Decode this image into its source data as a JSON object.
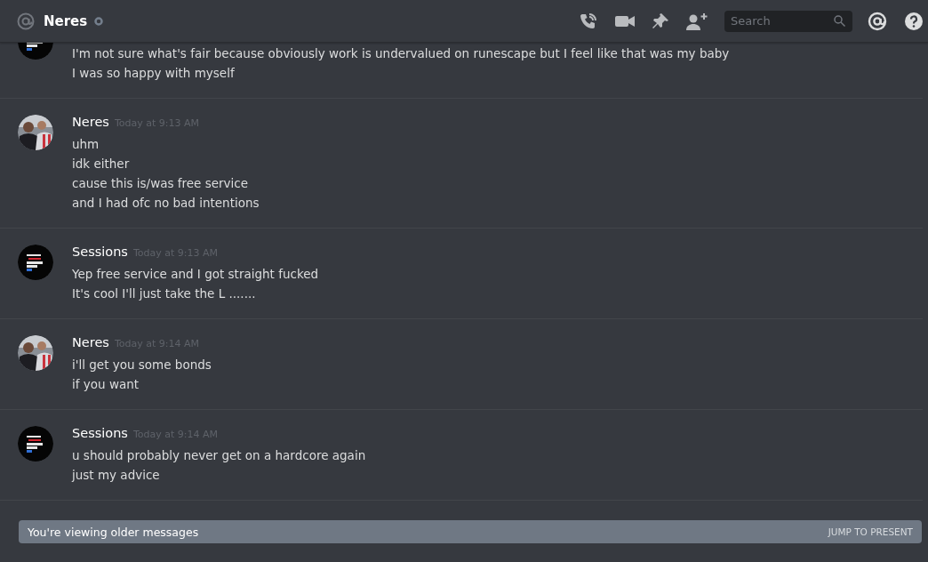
{
  "header": {
    "channel_name": "Neres",
    "search": {
      "placeholder": "Search"
    }
  },
  "messages": [
    {
      "avatar": {
        "kind": "picture"
      },
      "lines": [
        "I'm not sure what's fair because obviously work is undervalued on runescape but I feel like that was my baby",
        "I was so happy with myself"
      ]
    },
    {
      "author": "Neres",
      "time": "Today at 9:13 AM",
      "avatar": {
        "kind": "picture"
      },
      "lines": [
        "uhm",
        "idk either",
        "cause this is/was free service",
        "and I had ofc no bad intentions"
      ]
    },
    {
      "author": "Sessions",
      "time": "Today at 9:13 AM",
      "avatar": {
        "kind": "picture"
      },
      "lines": [
        "Yep free service and I got straight fucked",
        "It's cool I'll just take the L ......."
      ]
    },
    {
      "author": "Neres",
      "time": "Today at 9:14 AM",
      "avatar": {
        "kind": "picture"
      },
      "lines": [
        "i'll get you some bonds",
        "if you want"
      ]
    },
    {
      "author": "Sessions",
      "time": "Today at 9:14 AM",
      "avatar": {
        "kind": "picture"
      },
      "lines": [
        "u should probably never get on a hardcore again",
        "just my advice"
      ]
    }
  ],
  "banner": {
    "text": "You're viewing older messages",
    "action": "JUMP TO PRESENT"
  }
}
